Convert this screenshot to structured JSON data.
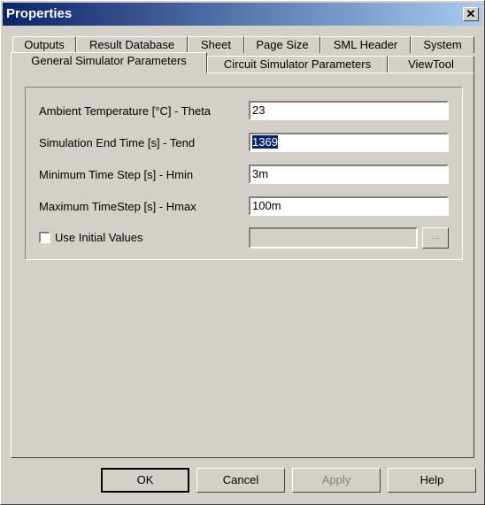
{
  "window": {
    "title": "Properties",
    "close_glyph": "✕"
  },
  "tabs_row1": [
    "Outputs",
    "Result Database",
    "Sheet",
    "Page Size",
    "SML Header",
    "System"
  ],
  "tabs_row2": [
    "General Simulator Parameters",
    "Circuit Simulator Parameters",
    "ViewTool"
  ],
  "fields": [
    {
      "label": "Ambient Temperature [°C] - Theta",
      "value": "23"
    },
    {
      "label": "Simulation End Time [s] - Tend",
      "value": "1369"
    },
    {
      "label": "Minimum Time Step [s] - Hmin",
      "value": "3m"
    },
    {
      "label": "Maximum TimeStep [s] - Hmax",
      "value": "100m"
    }
  ],
  "initial_values": {
    "label": "Use Initial Values",
    "checked": false,
    "path": "",
    "browse_label": "..."
  },
  "buttons": {
    "ok": "OK",
    "cancel": "Cancel",
    "apply": "Apply",
    "help": "Help"
  }
}
